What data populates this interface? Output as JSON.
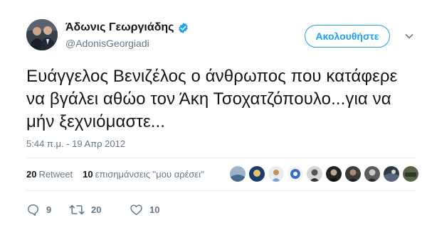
{
  "tweet": {
    "author": {
      "display_name": "Άδωνις Γεωργιάδης",
      "handle": "@AdonisGeorgiadi",
      "verified": true,
      "avatar_icon": "profile-photo"
    },
    "follow_label": "Ακολουθήστε",
    "menu_icon": "chevron-down-icon",
    "text": "Ευάγγελος Βενιζέλος ο άνθρωπος που κατάφερε να βγάλει αθώο τον Άκη Τσοχατζόπουλο...για να μήν ξεχνιόμαστε...",
    "timestamp": "5:44 π.μ. - 19 Απρ 2012",
    "stats": {
      "retweets_count": "20",
      "retweets_label": "Retweet",
      "likes_count": "10",
      "likes_label": "επισημάνσεις \"μου αρέσει\""
    },
    "liker_avatars_count": 10,
    "actions": {
      "reply_count": "9",
      "retweet_count": "20",
      "like_count": "10"
    },
    "colors": {
      "accent": "#1da1f2",
      "text": "#14171a",
      "muted": "#657786",
      "divider": "#e6ecf0"
    }
  }
}
